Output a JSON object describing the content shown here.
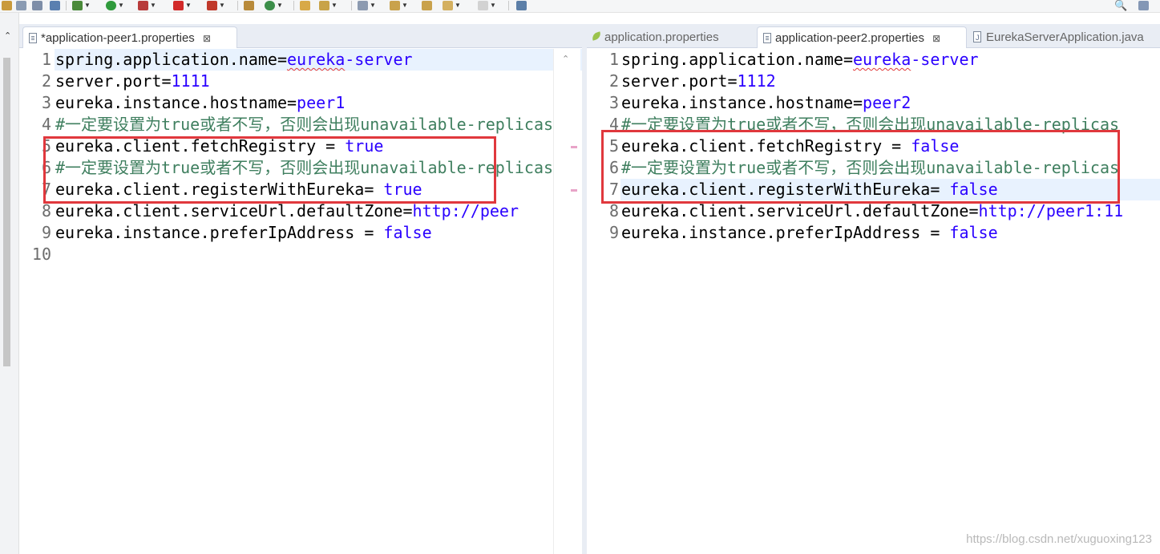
{
  "colors": {
    "keyword": "#000000",
    "value": "#2a00ff",
    "comment": "#3f7f5f",
    "highlight_box": "#e0383d",
    "current_line": "#e8f2fe"
  },
  "icons": [
    "search-icon",
    "file-icon",
    "close-icon",
    "spring-leaf-icon",
    "java-file-icon"
  ],
  "left_editor": {
    "tab": {
      "label": "*application-peer1.properties",
      "close": "⊠"
    },
    "lines": [
      {
        "no": "1",
        "parts": [
          {
            "t": "spring.application.name=",
            "s": "k"
          },
          {
            "t": "eureka",
            "s": "v sq"
          },
          {
            "t": "-server",
            "s": "v"
          }
        ]
      },
      {
        "no": "2",
        "parts": [
          {
            "t": "server.port=",
            "s": "k"
          },
          {
            "t": "1111",
            "s": "v"
          }
        ]
      },
      {
        "no": "3",
        "parts": [
          {
            "t": "eureka.instance.hostname=",
            "s": "k"
          },
          {
            "t": "peer1",
            "s": "v"
          }
        ]
      },
      {
        "no": "4",
        "parts": [
          {
            "t": "#一定要设置为true或者不写，否则会出现unavailable-replicas",
            "s": "c"
          }
        ]
      },
      {
        "no": "5",
        "parts": [
          {
            "t": "eureka.client.fetchRegistry = ",
            "s": "k"
          },
          {
            "t": "true",
            "s": "v"
          }
        ]
      },
      {
        "no": "6",
        "parts": [
          {
            "t": "#一定要设置为true或者不写，否则会出现unavailable-replicas",
            "s": "c"
          }
        ]
      },
      {
        "no": "7",
        "parts": [
          {
            "t": "eureka.client.registerWithEureka= ",
            "s": "k"
          },
          {
            "t": "true",
            "s": "v"
          }
        ]
      },
      {
        "no": "8",
        "parts": [
          {
            "t": "eureka.client.serviceUrl.defaultZone=",
            "s": "k"
          },
          {
            "t": "http://peer",
            "s": "v"
          }
        ]
      },
      {
        "no": "9",
        "parts": [
          {
            "t": "eureka.instance.preferIpAddress = ",
            "s": "k"
          },
          {
            "t": "false",
            "s": "v"
          }
        ]
      },
      {
        "no": "10",
        "parts": []
      }
    ]
  },
  "right_editor": {
    "tabs": [
      {
        "label": "application.properties",
        "icon": "spring-leaf-icon",
        "active": false
      },
      {
        "label": "application-peer2.properties",
        "icon": "file-icon",
        "active": true,
        "close": "⊠"
      },
      {
        "label": "EurekaServerApplication.java",
        "icon": "java-file-icon",
        "active": false
      }
    ],
    "lines": [
      {
        "no": "1",
        "parts": [
          {
            "t": "spring.application.name=",
            "s": "k"
          },
          {
            "t": "eureka",
            "s": "v sq"
          },
          {
            "t": "-server",
            "s": "v"
          }
        ]
      },
      {
        "no": "2",
        "parts": [
          {
            "t": "server.port=",
            "s": "k"
          },
          {
            "t": "1112",
            "s": "v"
          }
        ]
      },
      {
        "no": "3",
        "parts": [
          {
            "t": "eureka.instance.hostname=",
            "s": "k"
          },
          {
            "t": "peer2",
            "s": "v"
          }
        ]
      },
      {
        "no": "4",
        "parts": [
          {
            "t": "#一定要设置为true或者不写，否则会出现unavailable-replicas",
            "s": "c"
          }
        ]
      },
      {
        "no": "5",
        "parts": [
          {
            "t": "eureka.client.fetchRegistry = ",
            "s": "k"
          },
          {
            "t": "false",
            "s": "v"
          }
        ]
      },
      {
        "no": "6",
        "parts": [
          {
            "t": "#一定要设置为true或者不写，否则会出现unavailable-replicas",
            "s": "c"
          }
        ]
      },
      {
        "no": "7",
        "parts": [
          {
            "t": "eureka.client.registerWithEureka= ",
            "s": "k"
          },
          {
            "t": "false",
            "s": "v"
          }
        ]
      },
      {
        "no": "8",
        "parts": [
          {
            "t": "eureka.client.serviceUrl.defaultZone=",
            "s": "k"
          },
          {
            "t": "http://peer1:11",
            "s": "v"
          }
        ]
      },
      {
        "no": "9",
        "parts": [
          {
            "t": "eureka.instance.preferIpAddress = ",
            "s": "k"
          },
          {
            "t": "false",
            "s": "v"
          }
        ]
      }
    ]
  },
  "watermark": "https://blog.csdn.net/xuguoxing123"
}
